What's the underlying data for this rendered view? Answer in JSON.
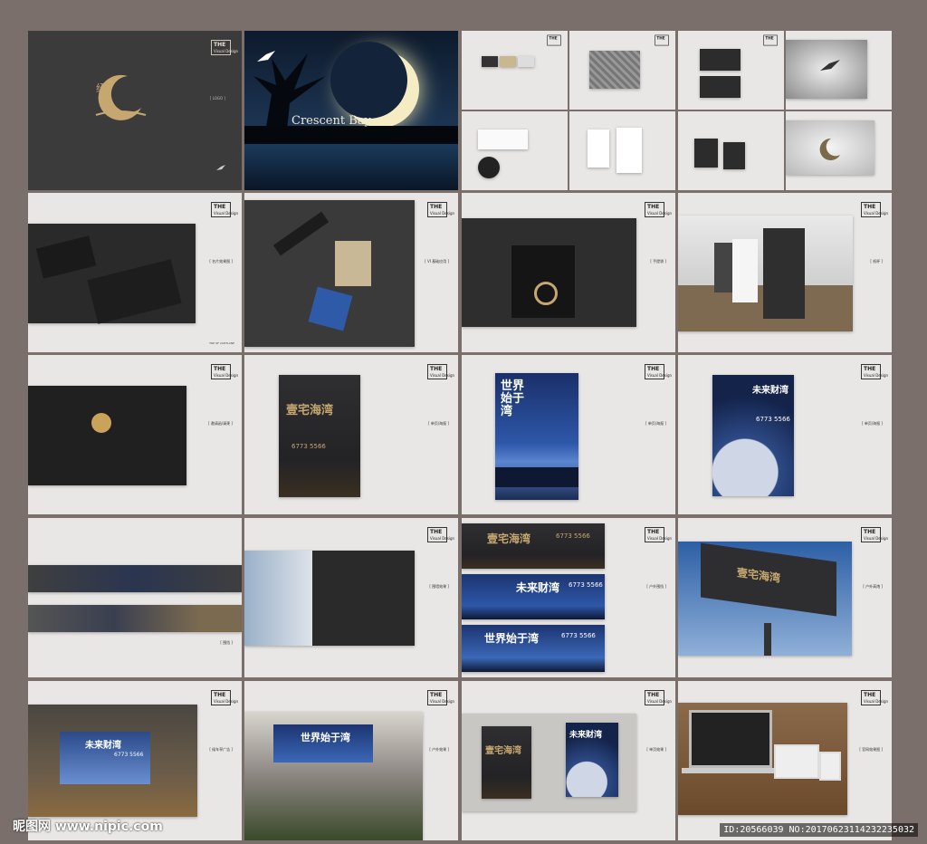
{
  "brand": {
    "the_label": "THE",
    "visual_label": "Visual Design",
    "footer_line1": "TOP OF CURTLANE",
    "footer_line2": "unidentified text",
    "logo_caption": "[ LOGO ]",
    "crescent_title": "Crescent Bay"
  },
  "captions": {
    "business_card": "[ 名片效果图 ]",
    "vi_set": "[ VI 基础应用 ]",
    "handbag": "[ 手提袋 ]",
    "cup": "[ 纸杯 ]",
    "envelope": "[ 邀请函/请柬 ]",
    "poster1": "[ 单页/海报 ]",
    "poster2": "[ 单页/海报 ]",
    "poster3": "[ 单页/海报 ]",
    "banner": "[ 围挡 ]",
    "wall": "[ 围墙效果 ]",
    "outdoor": "[ 户外围挡 ]",
    "billboard": "[ 户外高炮 ]",
    "busstop": "[ 候车亭广告 ]",
    "building": "[ 户外效果 ]",
    "flyer": "[ 单页效果 ]",
    "web": "[ 官网效果图 ]"
  },
  "posters": {
    "p1_title": "壹宅海湾",
    "p1_phone": "6773 5566",
    "p2_title": "世界始于湾",
    "p3_title": "未来财湾",
    "p3_phone": "6773 5566"
  },
  "banners": {
    "b1_title": "壹宅海湾",
    "b1_phone": "6773 5566",
    "b2_title": "未来财湾",
    "b2_phone": "6773 5566",
    "b3_title": "世界始于湾",
    "b3_phone": "6773 5566"
  },
  "billboard_title": "壹宅海湾",
  "busstop": {
    "title": "未来财湾",
    "phone": "6773 5566"
  },
  "building_title": "世界始于湾",
  "flyers": {
    "f1": "壹宅海湾",
    "f2": "未来财湾"
  },
  "watermark": "昵图网 www.nipic.com",
  "id_tag": "ID:20566039 NO:20170623114232235032",
  "colors": {
    "background": "#7a6f6b",
    "panel": "#e8e7e5",
    "dark": "#3b3b3b",
    "gold": "#c6a770",
    "night": "#1c2a4a"
  }
}
